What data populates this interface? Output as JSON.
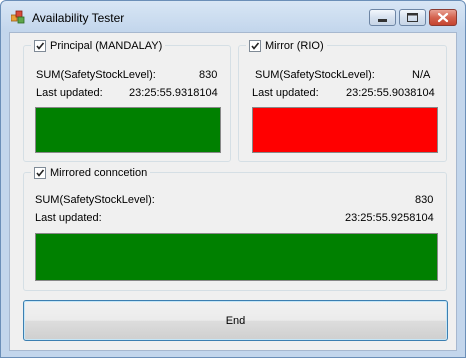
{
  "window": {
    "title": "Availability Tester",
    "icon": "app-icon"
  },
  "principal": {
    "checkbox_checked": true,
    "label": "Principal (MANDALAY)",
    "sum_label": "SUM(SafetyStockLevel):",
    "sum_value": "830",
    "updated_label": "Last updated:",
    "updated_value": "23:25:55.9318104",
    "status_color": "#008000"
  },
  "mirror": {
    "checkbox_checked": true,
    "label": "Mirror (RIO)",
    "sum_label": "SUM(SafetyStockLevel):",
    "sum_value": "N/A",
    "updated_label": "Last updated:",
    "updated_value": "23:25:55.9038104",
    "status_color": "#ff0000"
  },
  "mirrored": {
    "checkbox_checked": true,
    "label": "Mirrored conncetion",
    "sum_label": "SUM(SafetyStockLevel):",
    "sum_value": "830",
    "updated_label": "Last updated:",
    "updated_value": "23:25:55.9258104",
    "status_color": "#008000"
  },
  "end_button": {
    "label": "End"
  }
}
